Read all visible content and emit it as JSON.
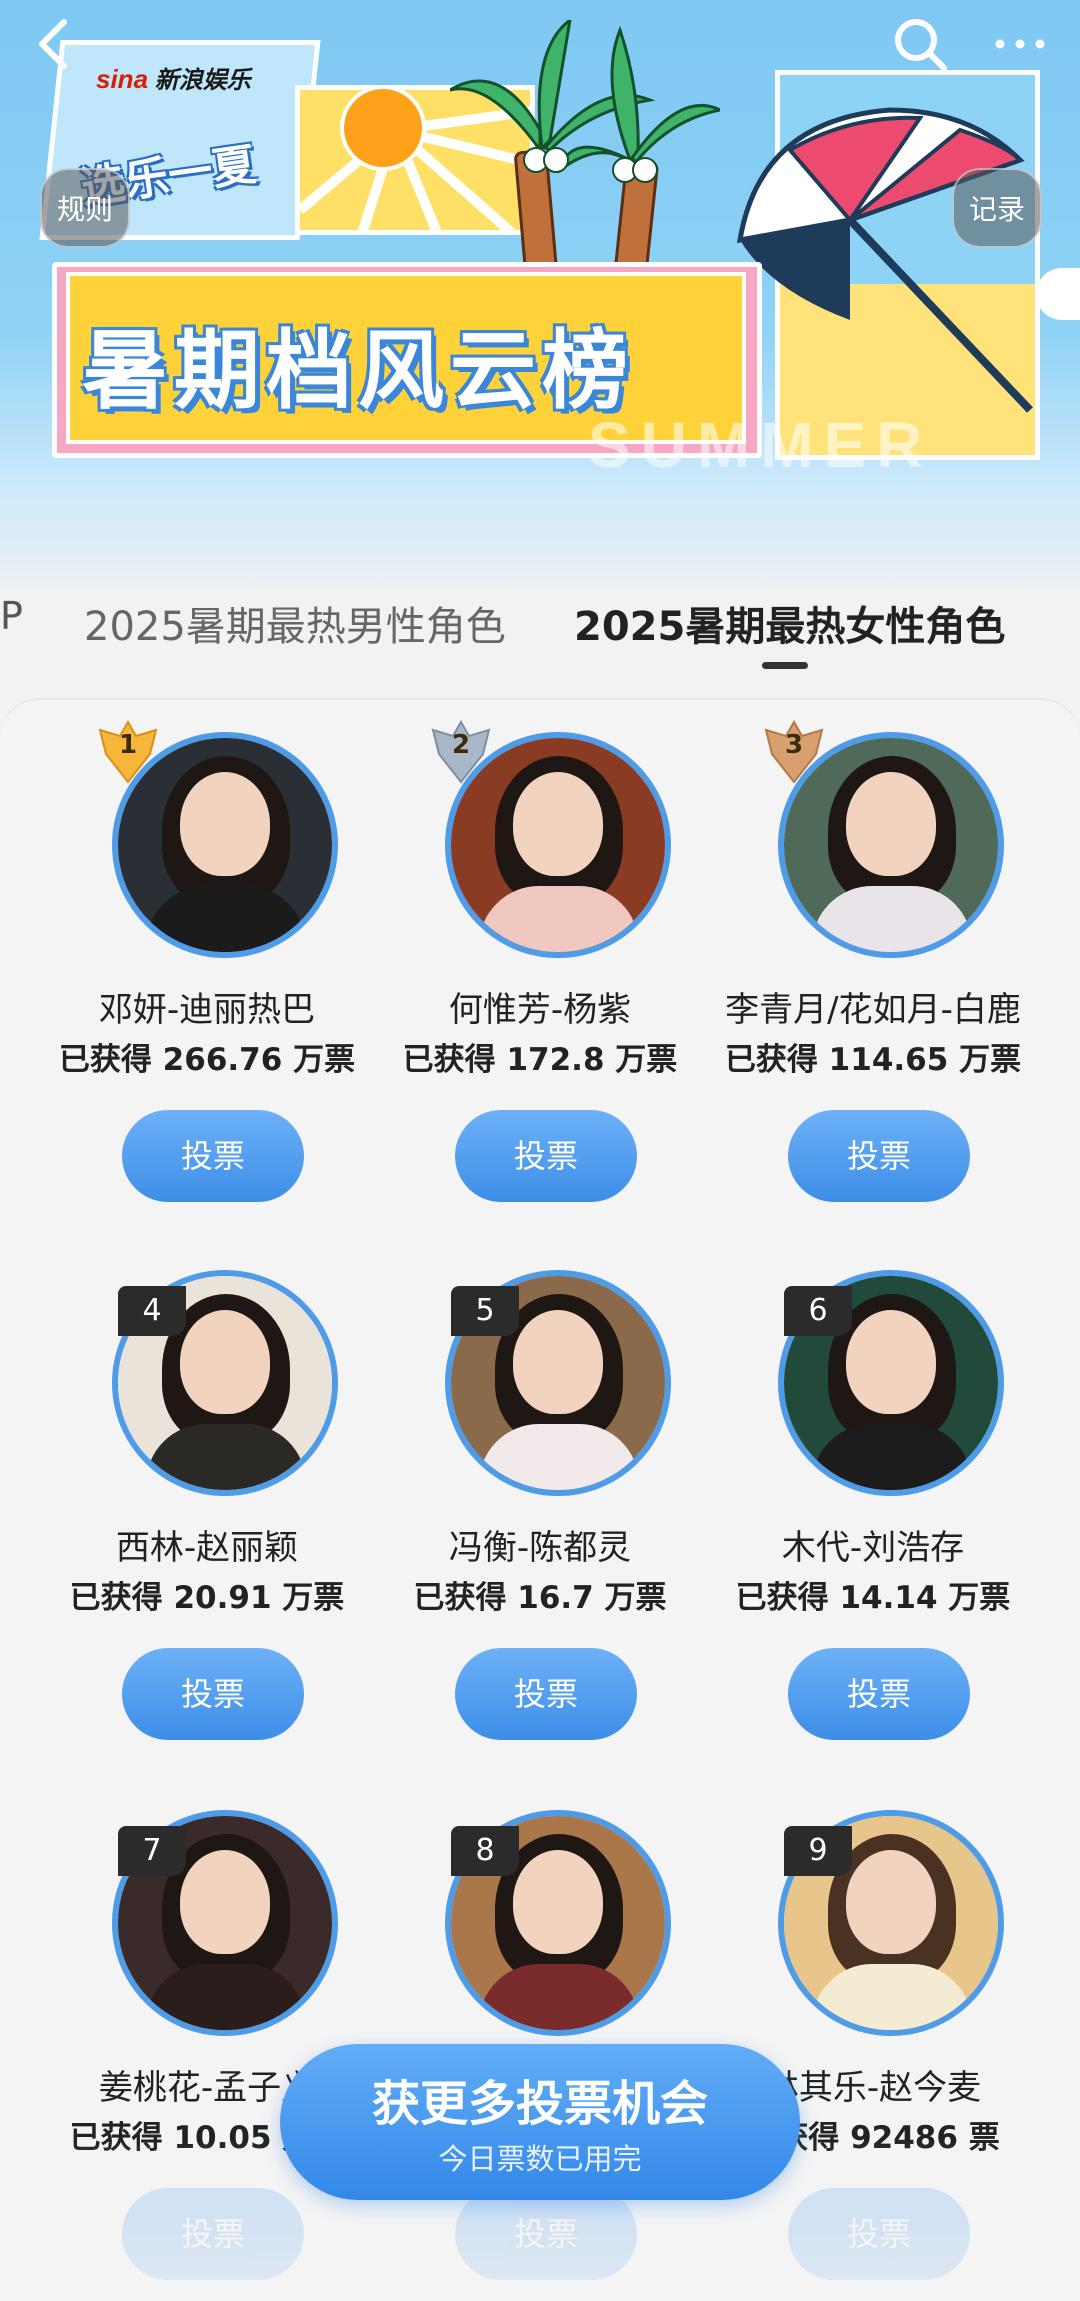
{
  "banner": {
    "brand_logo": "sina",
    "brand_name": "新浪娱乐",
    "campaign": "选乐一夏",
    "title": "暑期档风云榜",
    "watermark": "SUMMER",
    "rules_label": "规则",
    "records_label": "记录"
  },
  "tabs": {
    "partial": "P",
    "male": "2025暑期最热男性角色",
    "female": "2025暑期最热女性角色",
    "active": "female"
  },
  "entries": [
    {
      "rank": "1",
      "name": "邓妍-迪丽热巴",
      "votes": "已获得 266.76 万票",
      "button": "投票"
    },
    {
      "rank": "2",
      "name": "何惟芳-杨紫",
      "votes": "已获得 172.8 万票",
      "button": "投票"
    },
    {
      "rank": "3",
      "name": "李青月/花如月-白鹿",
      "votes": "已获得 114.65 万票",
      "button": "投票"
    },
    {
      "rank": "4",
      "name": "西林-赵丽颖",
      "votes": "已获得 20.91 万票",
      "button": "投票"
    },
    {
      "rank": "5",
      "name": "冯衡-陈都灵",
      "votes": "已获得 16.7 万票",
      "button": "投票"
    },
    {
      "rank": "6",
      "name": "木代-刘浩存",
      "votes": "已获得 14.14 万票",
      "button": "投票"
    },
    {
      "rank": "7",
      "name": "姜桃花-孟子义",
      "votes": "已获得 10.05 万票",
      "button": "投票"
    },
    {
      "rank": "8",
      "name": "",
      "votes": "",
      "button": "投票"
    },
    {
      "rank": "9",
      "name": "林其乐-赵今麦",
      "votes": "已获得 92486 票",
      "button": "投票"
    }
  ],
  "cta": {
    "title": "获更多投票机会",
    "subtitle": "今日票数已用完"
  },
  "colors": {
    "accent": "#3d8ee8",
    "banner_sky": "#7ec8f3",
    "gold": "#f5b63a",
    "silver": "#a9b8c8",
    "bronze": "#d8a070"
  },
  "icons": [
    "back-arrow-icon",
    "search-icon",
    "more-icon"
  ]
}
